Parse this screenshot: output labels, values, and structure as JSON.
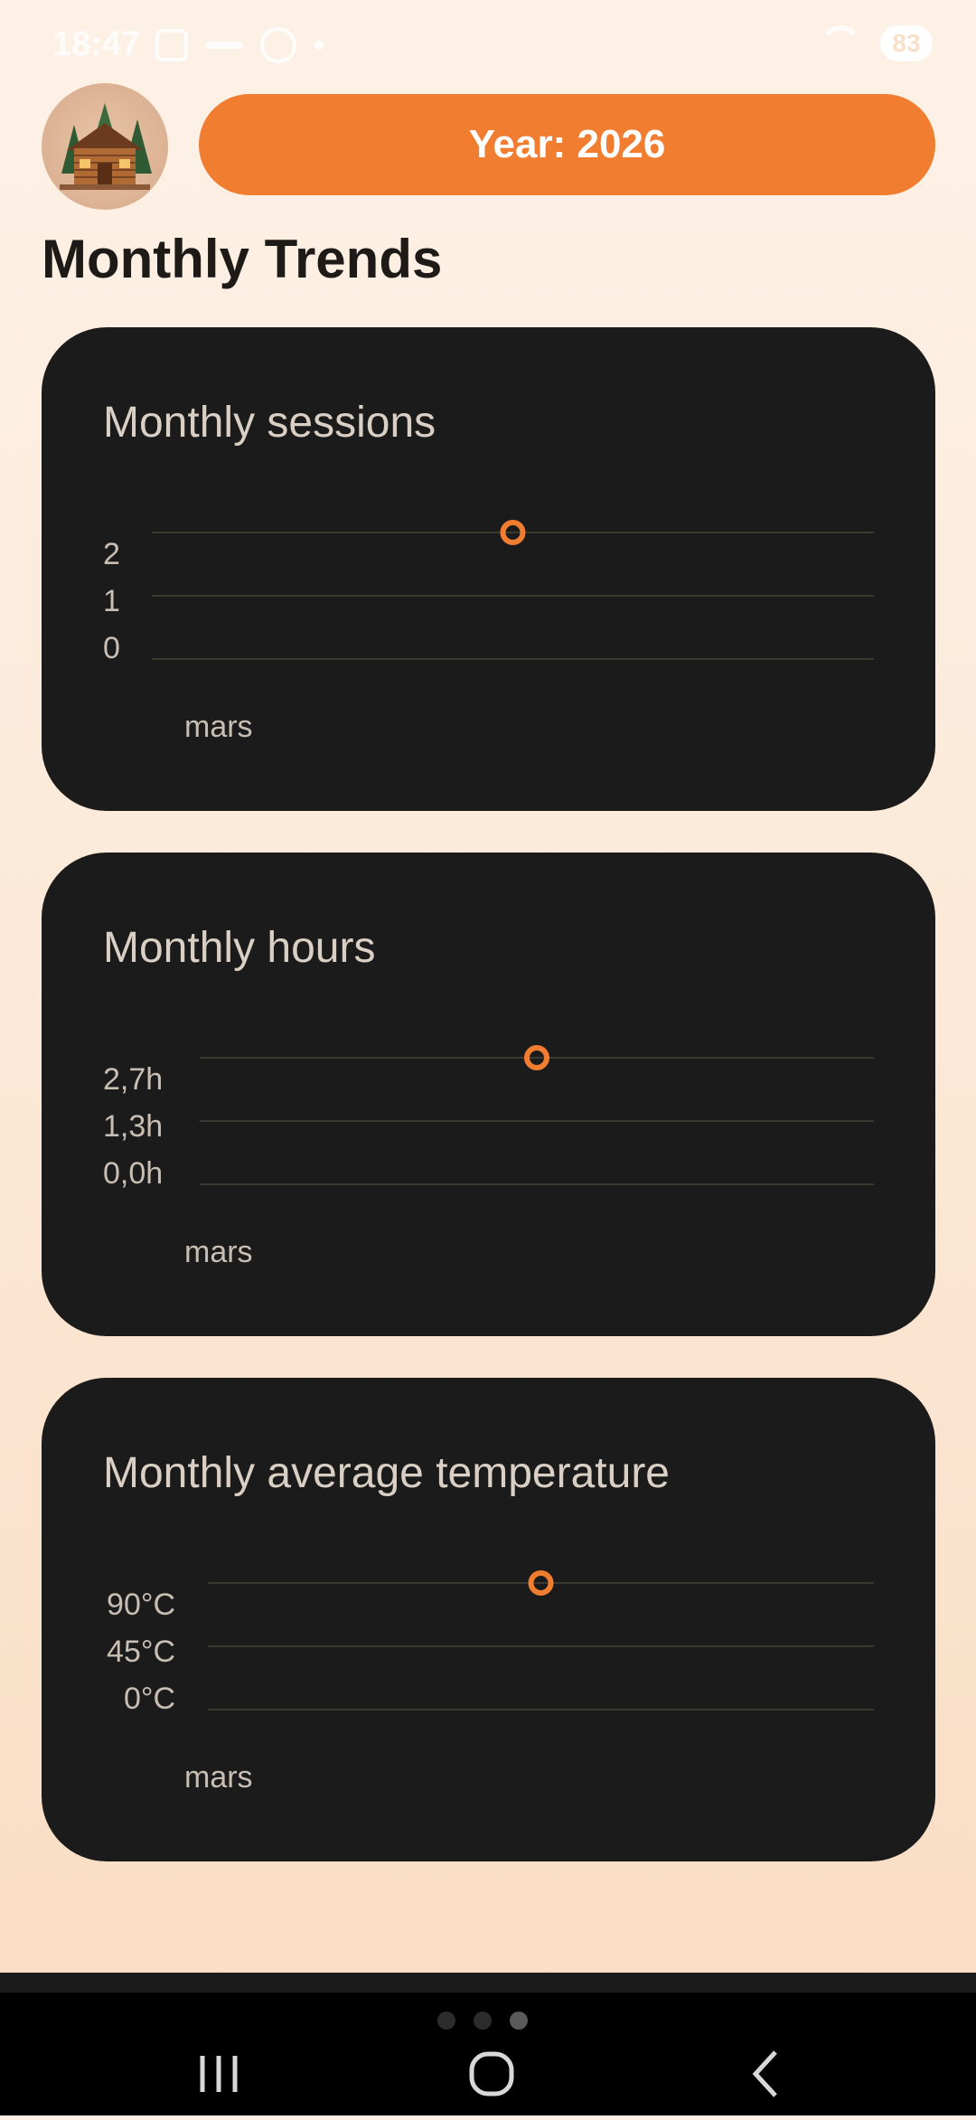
{
  "status_bar": {
    "time": "18:47",
    "battery": "83"
  },
  "header": {
    "avatar_icon": "log-cabin-icon",
    "year_button_label": "Year: 2026"
  },
  "page_title": "Monthly Trends",
  "colors": {
    "accent": "#f07d30",
    "card_background": "#1c1b1b",
    "page_background": "#fdf1e6"
  },
  "cards": [
    {
      "title": "Monthly sessions"
    },
    {
      "title": "Monthly hours"
    },
    {
      "title": "Monthly average temperature"
    }
  ],
  "chart_data": [
    {
      "type": "line",
      "title": "Monthly sessions",
      "categories": [
        "mars"
      ],
      "y_ticks": [
        "0",
        "1",
        "2"
      ],
      "ylim": [
        0,
        2
      ],
      "values": [
        2
      ],
      "grid": true
    },
    {
      "type": "line",
      "title": "Monthly hours",
      "categories": [
        "mars"
      ],
      "y_ticks": [
        "0,0h",
        "1,3h",
        "2,7h"
      ],
      "ylim": [
        0,
        2.7
      ],
      "values": [
        2.7
      ],
      "grid": true
    },
    {
      "type": "line",
      "title": "Monthly average temperature",
      "categories": [
        "mars"
      ],
      "y_ticks": [
        "0°C",
        "45°C",
        "90°C"
      ],
      "ylim": [
        0,
        90
      ],
      "values": [
        90
      ],
      "grid": true
    }
  ],
  "nav": {
    "recents_icon": "recents-icon",
    "home_icon": "home-icon",
    "back_icon": "back-icon"
  }
}
